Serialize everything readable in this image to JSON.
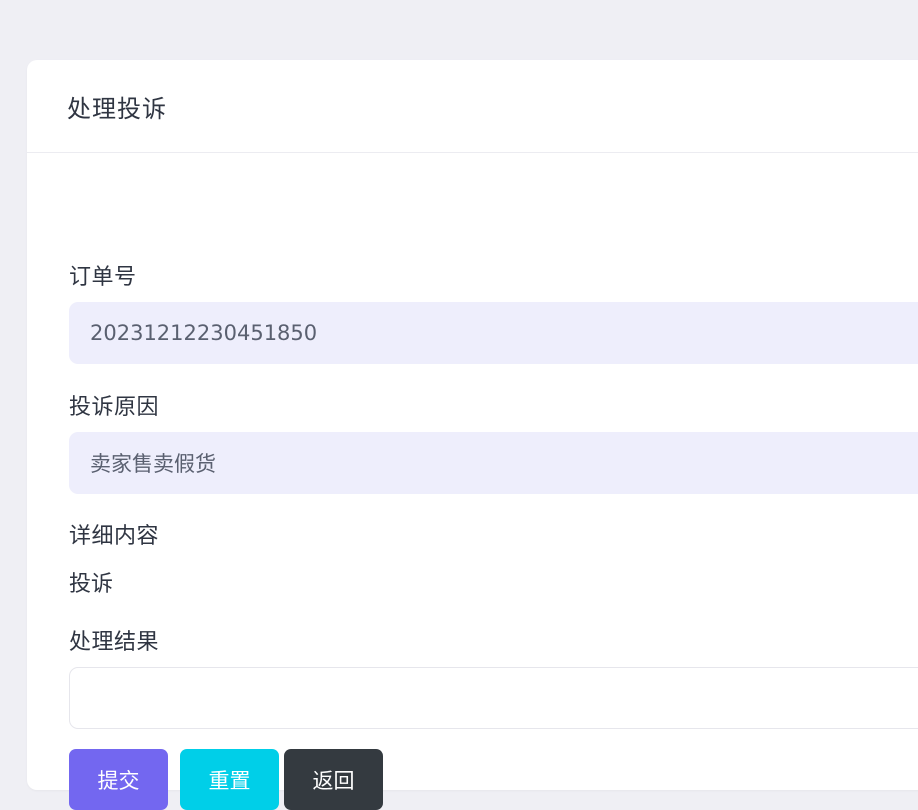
{
  "card": {
    "title": "处理投诉"
  },
  "form": {
    "order_no": {
      "label": "订单号",
      "value": "20231212230451850"
    },
    "reason": {
      "label": "投诉原因",
      "value": "卖家售卖假货"
    },
    "details": {
      "label": "详细内容",
      "value": "投诉"
    },
    "result": {
      "label": "处理结果",
      "value": ""
    }
  },
  "buttons": {
    "submit": "提交",
    "reset": "重置",
    "back": "返回"
  },
  "colors": {
    "background": "#efeff4",
    "readonly_field": "#eeeefc",
    "submit": "#7367f0",
    "reset": "#00cfe8",
    "back": "#343a40"
  }
}
